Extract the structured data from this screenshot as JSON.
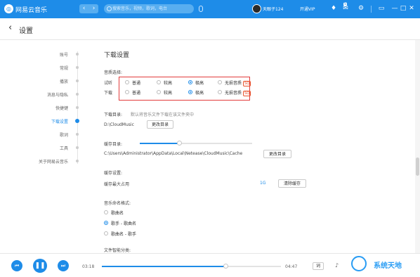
{
  "colors": {
    "accent": "#1e8ce8",
    "highlight_box": "#e23b3b"
  },
  "app": {
    "name": "网易云音乐",
    "logo_icon": "netease-cloud-music-logo"
  },
  "topbar": {
    "search_placeholder": "搜索音乐，视频，歌词，电台",
    "username": "天眼子124",
    "vip_label": "开通VIP",
    "message_count": "5"
  },
  "header": {
    "title": "设置"
  },
  "sidebar": {
    "items": [
      {
        "label": "账号"
      },
      {
        "label": "常规"
      },
      {
        "label": "播放"
      },
      {
        "label": "消息与隐私"
      },
      {
        "label": "快捷键"
      },
      {
        "label": "下载设置"
      },
      {
        "label": "歌词"
      },
      {
        "label": "工具"
      },
      {
        "label": "关于网易云音乐"
      }
    ],
    "active": "下载设置"
  },
  "download": {
    "title": "下载设置",
    "quality_label": "音质选择:",
    "rows": [
      {
        "label": "试听",
        "selected": "极高"
      },
      {
        "label": "下载",
        "selected": "极高"
      }
    ],
    "options": [
      "普通",
      "较高",
      "极高",
      "无损音质"
    ],
    "sq_badge": "SQ",
    "dir_label": "下载目录:",
    "dir_hint": "默认将音乐文件下载在该文件夹中",
    "dir_value": "D:\\CloudMusic",
    "dir_button": "更改目录"
  },
  "cache": {
    "dir_label": "缓存目录:",
    "dir_value": "C:\\Users\\Administrator\\AppData\\Local\\Netease\\CloudMusic\\Cache",
    "dir_button": "更改目录",
    "settings_label": "缓存设置:",
    "max_label": "缓存最大占用",
    "max_value": "1G",
    "level_fraction": 0.35,
    "clear_button": "清除缓存"
  },
  "naming": {
    "label": "音乐命名格式:",
    "options": [
      {
        "label": "歌曲名",
        "selected": false
      },
      {
        "label": "歌手 - 歌曲名",
        "selected": true
      },
      {
        "label": "歌曲名 - 歌手",
        "selected": false
      }
    ],
    "next_label": "文件智能分类:"
  },
  "player": {
    "current_time": "03:18",
    "total_time": "04:47",
    "progress_fraction": 0.69,
    "lyrics_button": "词",
    "prev_icon": "previous-icon",
    "pause_icon": "pause-icon",
    "next_icon": "next-icon"
  },
  "watermark": {
    "text": "系统天地"
  }
}
